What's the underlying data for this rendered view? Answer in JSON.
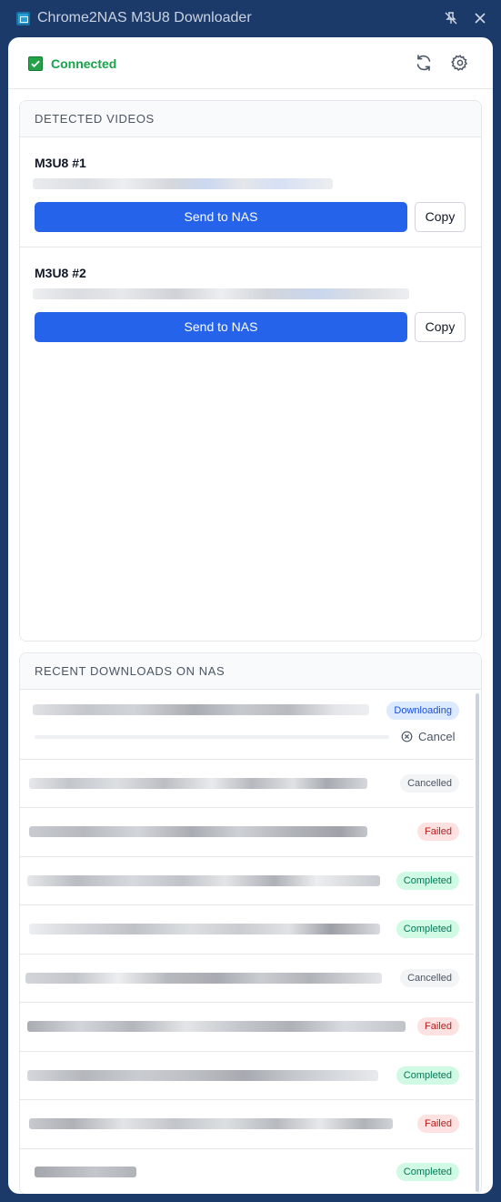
{
  "window": {
    "title": "Chrome2NAS M3U8 Downloader"
  },
  "header": {
    "status": "Connected"
  },
  "detected": {
    "heading": "DETECTED VIDEOS",
    "items": [
      {
        "name": "M3U8 #1",
        "send_label": "Send to NAS",
        "copy_label": "Copy"
      },
      {
        "name": "M3U8 #2",
        "send_label": "Send to NAS",
        "copy_label": "Copy"
      }
    ]
  },
  "downloads": {
    "heading": "RECENT DOWNLOADS ON NAS",
    "cancel_label": "Cancel",
    "items": [
      {
        "status": "Downloading",
        "progress": 0.0
      },
      {
        "status": "Cancelled"
      },
      {
        "status": "Failed"
      },
      {
        "status": "Completed"
      },
      {
        "status": "Completed"
      },
      {
        "status": "Cancelled"
      },
      {
        "status": "Failed"
      },
      {
        "status": "Completed"
      },
      {
        "status": "Failed"
      },
      {
        "status": "Completed"
      }
    ]
  },
  "colors": {
    "window_bg": "#1c3a69",
    "accent": "#2563eb",
    "connected": "#16a34a"
  }
}
